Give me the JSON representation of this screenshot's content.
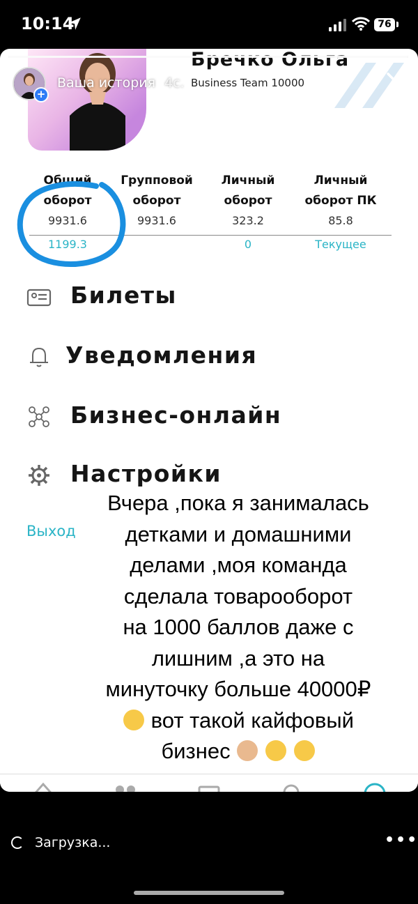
{
  "status_bar": {
    "time": "10:14",
    "battery": "76"
  },
  "story_header": {
    "your_story": "Ваша история",
    "age": "4с.",
    "profile_name": "Бречко Ольга",
    "team": "Business Team 10000"
  },
  "turnover_table": {
    "headers": [
      [
        "Общий",
        "оборот"
      ],
      [
        "Групповой",
        "оборот"
      ],
      [
        "Личный",
        "оборот"
      ],
      [
        "Личный",
        "оборот ПК"
      ]
    ],
    "values": [
      "9931.6",
      "9931.6",
      "323.2",
      "85.8"
    ],
    "sub_values": [
      "1199.3",
      "",
      "0",
      "Текущее"
    ]
  },
  "menu": {
    "items": [
      {
        "label": "Билеты",
        "icon": "ticket-icon"
      },
      {
        "label": "Уведомления",
        "icon": "bell-icon"
      },
      {
        "label": "Бизнес-онлайн",
        "icon": "network-icon"
      },
      {
        "label": "Настройки",
        "icon": "gear-icon"
      }
    ],
    "logout": "Выход"
  },
  "caption": {
    "lines": [
      "Вчера ,пока я занималась",
      "детками и домашними",
      "делами ,моя команда",
      "сделала товарооборот",
      "на 1000 баллов даже с",
      "лишним ,а это на",
      "минуточку больше 40000₽",
      "вот такой кайфовый",
      "бизнес"
    ]
  },
  "footer": {
    "loading": "Загрузка..."
  },
  "colors": {
    "accent": "#2ab4c6",
    "highlight_circle": "#1a8fe0",
    "background": "#000000"
  }
}
